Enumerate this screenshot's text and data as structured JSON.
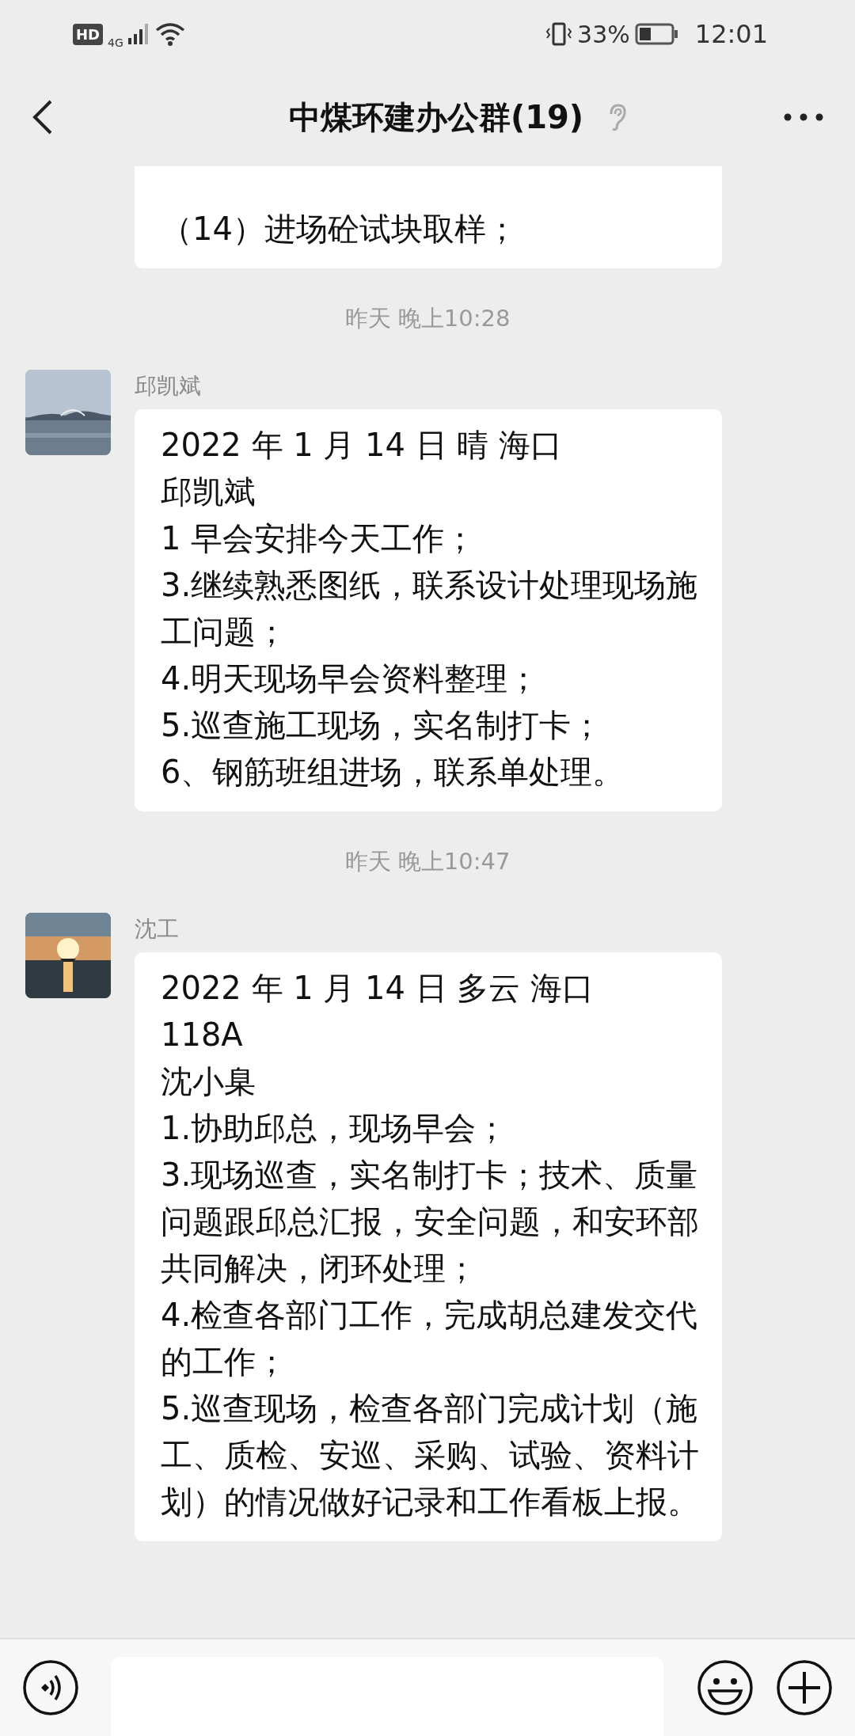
{
  "status_bar": {
    "hd": "HD",
    "network": "4G",
    "battery": "33%",
    "time": "12:01"
  },
  "header": {
    "title": "中煤环建办公群(19)"
  },
  "chat": [
    {
      "kind": "message",
      "cut": true,
      "lines": [
        "（14）进场砼试块取样；"
      ]
    },
    {
      "kind": "time",
      "text": "昨天 晚上10:28"
    },
    {
      "kind": "message",
      "sender": "邱凯斌",
      "lines": [
        "2022 年 1 月 14 日  晴   海口",
        "邱凯斌",
        "1 早会安排今天工作；",
        "3.继续熟悉图纸，联系设计处理现场施工问题；",
        "4.明天现场早会资料整理；",
        "5.巡查施工现场，实名制打卡；",
        "6、钢筋班组进场，联系单处理。"
      ]
    },
    {
      "kind": "time",
      "text": "昨天 晚上10:47"
    },
    {
      "kind": "message",
      "sender": "沈工",
      "lines": [
        "2022 年 1 月 14 日 多云   海口",
        "118A",
        "沈小臬",
        "1.协助邱总，现场早会；",
        "3.现场巡查，实名制打卡；技术、质量问题跟邱总汇报，安全问题，和安环部共同解决，闭环处理；",
        "4.检查各部门工作，完成胡总建发交代的工作；",
        "5.巡查现场，检查各部门完成计划（施工、质检、安巡、采购、试验、资料计划）的情况做好记录和工作看板上报。"
      ]
    }
  ]
}
